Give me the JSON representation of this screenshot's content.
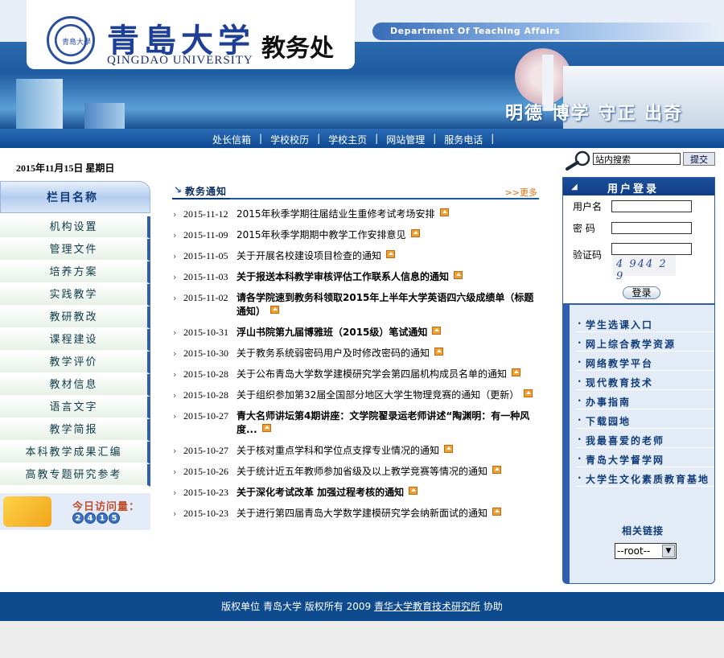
{
  "header": {
    "cn_name": "青島大学",
    "en_name": "QINGDAO UNIVERSITY",
    "office": "教务处",
    "dept_en": "Department Of Teaching Affairs",
    "motto": "明德 博学 守正 出奇"
  },
  "nav": [
    "处长信箱",
    "学校校历",
    "学校主页",
    "网站管理",
    "服务电话"
  ],
  "date": "2015年11月15日 星期日",
  "search": {
    "value": "站内搜索",
    "button": "提交"
  },
  "sidebar": {
    "title": "栏目名称",
    "items": [
      "机构设置",
      "管理文件",
      "培养方案",
      "实践教学",
      "教研教改",
      "课程建设",
      "教学评价",
      "教材信息",
      "语言文字",
      "教学简报",
      "本科教学成果汇编",
      "高教专题研究参考"
    ],
    "visit_label": "今日访问量：",
    "visit_digits": [
      "2",
      "4",
      "1",
      "5"
    ]
  },
  "notices": {
    "title": "教务通知",
    "more": ">>更多",
    "items": [
      {
        "date": "2015-11-12",
        "text": "2015年秋季学期往届结业生重修考试考场安排",
        "bold": false
      },
      {
        "date": "2015-11-09",
        "text": "2015年秋季学期期中教学工作安排意见",
        "bold": false
      },
      {
        "date": "2015-11-05",
        "text": "关于开展名校建设项目检查的通知",
        "bold": false
      },
      {
        "date": "2015-11-03",
        "text": "关于报送本科教学审核评估工作联系人信息的通知",
        "bold": true
      },
      {
        "date": "2015-11-02",
        "text": "请各学院速到教务科领取2015年上半年大学英语四六级成绩单（标题通知）",
        "bold": true
      },
      {
        "date": "2015-10-31",
        "text": "浮山书院第九届博雅班（2015级）笔试通知",
        "bold": true
      },
      {
        "date": "2015-10-30",
        "text": "关于教务系统弱密码用户及时修改密码的通知",
        "bold": false
      },
      {
        "date": "2015-10-28",
        "text": "关于公布青岛大学数学建模研究学会第四届机构成员名单的通知",
        "bold": false
      },
      {
        "date": "2015-10-28",
        "text": "关于组织参加第32届全国部分地区大学生物理竞赛的通知（更新）",
        "bold": false
      },
      {
        "date": "2015-10-27",
        "text": "青大名师讲坛第4期讲座：文学院翟录运老师讲述“陶渊明：有一种风度...",
        "bold": true
      },
      {
        "date": "2015-10-27",
        "text": "关于核对重点学科和学位点支撑专业情况的通知",
        "bold": false
      },
      {
        "date": "2015-10-26",
        "text": "关于统计近五年教师参加省级及以上教学竞赛等情况的通知",
        "bold": false
      },
      {
        "date": "2015-10-23",
        "text": "关于深化考试改革 加强过程考核的通知",
        "bold": true
      },
      {
        "date": "2015-10-23",
        "text": "关于进行第四届青岛大学数学建模研究学会纳新面试的通知",
        "bold": false
      }
    ]
  },
  "login": {
    "title": "用户登录",
    "username_label": "用户名",
    "password_label": "密 码",
    "captcha_label": "验证码",
    "captcha_text": "4 944 2 9",
    "button": "登录"
  },
  "links": {
    "items": [
      "学生选课入口",
      "网上综合教学资源",
      "网络教学平台",
      "现代教育技术",
      "办事指南",
      "下载园地",
      "我最喜爱的老师",
      "青岛大学督学网",
      "大学生文化素质教育基地"
    ],
    "related_title": "相关链接",
    "related_select": "--root--"
  },
  "footer": {
    "pre": "版权单位 青岛大学 版权所有 2009",
    "link": "青华大学教育技术研究所",
    "post": "协助"
  }
}
